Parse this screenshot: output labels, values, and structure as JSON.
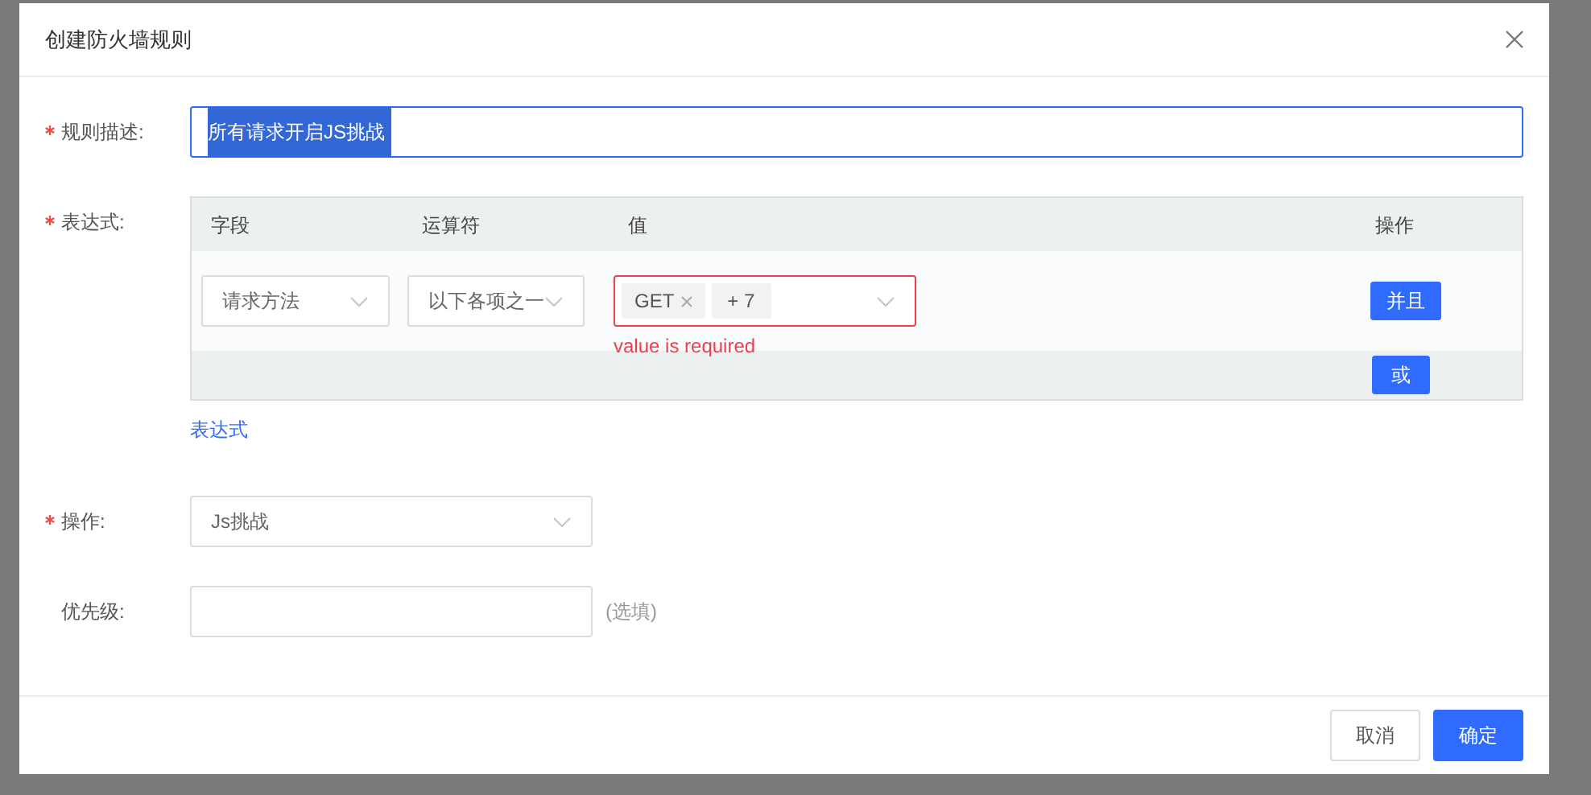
{
  "dialog": {
    "title": "创建防火墙规则"
  },
  "description": {
    "label": "规则描述:",
    "required": true,
    "value": "所有请求开启JS挑战",
    "text_selected": true
  },
  "expression": {
    "label": "表达式:",
    "required": true,
    "columns": [
      "字段",
      "运算符",
      "值",
      "操作"
    ],
    "rows": [
      {
        "field": "请求方法",
        "operator": "以下各项之一",
        "tags": [
          "GET"
        ],
        "more": "+ 7",
        "error": "value is required",
        "and_button": "并且"
      }
    ],
    "or_button": "或",
    "add_link": "表达式"
  },
  "action": {
    "label": "操作:",
    "required": true,
    "value": "Js挑战"
  },
  "priority": {
    "label": "优先级:",
    "required": false,
    "hint": "(选填)"
  },
  "buttons": [
    {
      "label": "取消",
      "kind": "secondary"
    },
    {
      "label": "确定",
      "kind": "primary"
    }
  ]
}
